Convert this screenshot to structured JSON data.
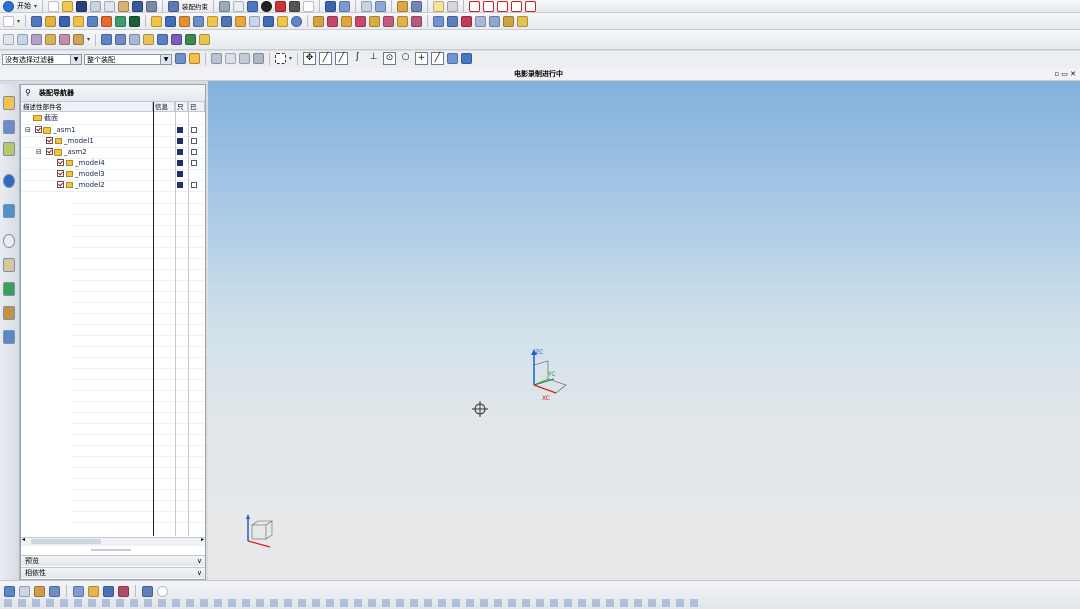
{
  "menu": {
    "start_label": "开始",
    "assembly_constraint_label": "装配约束"
  },
  "filters": {
    "selection_filter": "没有选择过滤器",
    "assembly_scope": "整个装配"
  },
  "status": {
    "recording_text": "电影录制进行中"
  },
  "navigator": {
    "title": "装配导航器",
    "columns": {
      "name": "描述性部件名",
      "info": "信息",
      "readonly": "只",
      "modified": "已"
    },
    "rows": [
      {
        "label": "截面",
        "level": 0,
        "kind": "section"
      },
      {
        "label": "_asm1",
        "level": 0,
        "kind": "assembly",
        "expanded": true
      },
      {
        "label": "_model1",
        "level": 1,
        "kind": "part"
      },
      {
        "label": "_asm2",
        "level": 1,
        "kind": "assembly",
        "expanded": true
      },
      {
        "label": "_model4",
        "level": 2,
        "kind": "part"
      },
      {
        "label": "_model3",
        "level": 2,
        "kind": "part"
      },
      {
        "label": "_model2",
        "level": 2,
        "kind": "part"
      }
    ],
    "panels": {
      "preview": "预览",
      "dependencies": "相依性"
    }
  },
  "viewport": {
    "wcs_labels": {
      "z": "ZC",
      "y": "YC",
      "x": "XC"
    }
  },
  "colors": {
    "sky_top": "#82b0dc",
    "ground": "#e8e8e9",
    "axis_z": "#1f5fcf",
    "axis_y": "#1fa13a",
    "axis_x": "#d42020"
  }
}
